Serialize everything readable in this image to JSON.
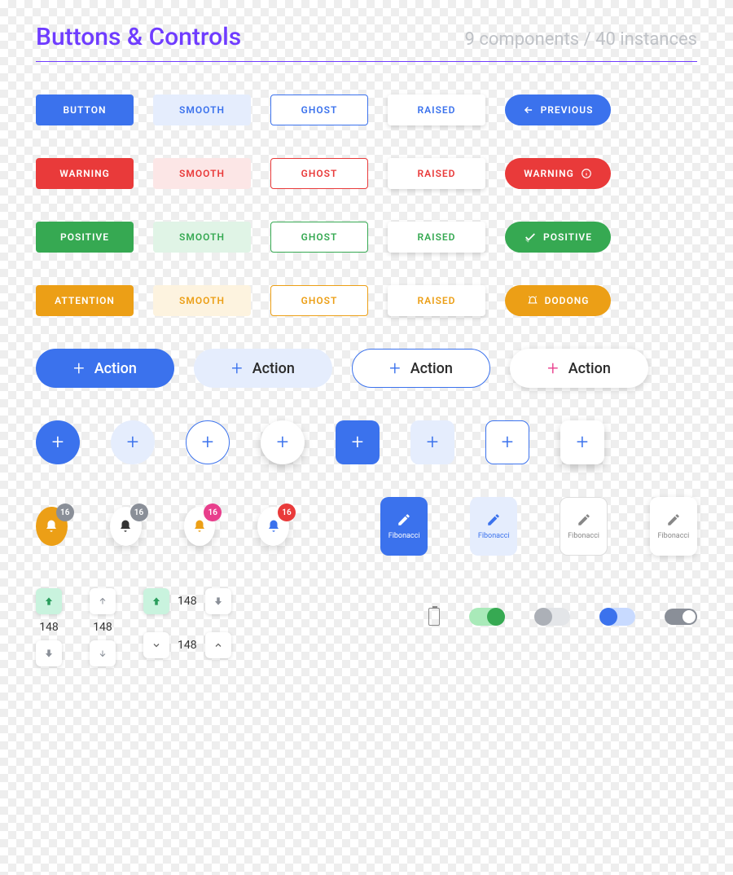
{
  "header": {
    "title": "Buttons & Controls",
    "subtitle": "9 components  / 40 instances"
  },
  "rows": {
    "blue": {
      "solid": "BUTTON",
      "smooth": "SMOOTH",
      "ghost": "GHOST",
      "raised": "RAISED",
      "pill": "PREVIOUS"
    },
    "red": {
      "solid": "WARNING",
      "smooth": "SMOOTH",
      "ghost": "GHOST",
      "raised": "RAISED",
      "pill": "WARNING"
    },
    "green": {
      "solid": "POSITIVE",
      "smooth": "SMOOTH",
      "ghost": "GHOST",
      "raised": "RAISED",
      "pill": "POSITIVE"
    },
    "orange": {
      "solid": "ATTENTION",
      "smooth": "SMOOTH",
      "ghost": "GHOST",
      "raised": "RAISED",
      "pill": "DODONG"
    }
  },
  "action_label": "Action",
  "badge_count": "16",
  "card_label": "Fibonacci",
  "stepper_value": "148"
}
